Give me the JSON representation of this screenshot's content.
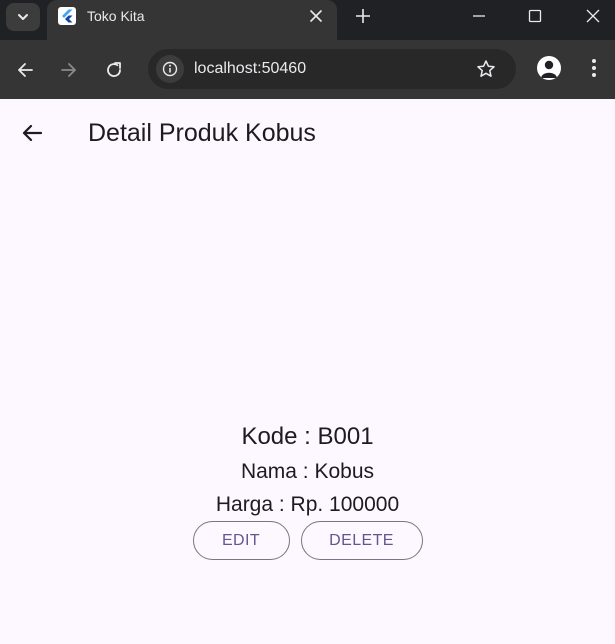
{
  "browser": {
    "tab_title": "Toko Kita",
    "url": "localhost:50460"
  },
  "app": {
    "title": "Detail Produk Kobus"
  },
  "product": {
    "kode_line": "Kode : B001",
    "nama_line": "Nama : Kobus",
    "harga_line": "Harga : Rp. 100000"
  },
  "actions": {
    "edit_label": "EDIT",
    "delete_label": "DELETE"
  },
  "colors": {
    "browser_frame": "#202124",
    "browser_toolbar": "#353535",
    "app_background": "#fdf7ff",
    "button_text": "#65558f",
    "button_border": "#79747e"
  }
}
